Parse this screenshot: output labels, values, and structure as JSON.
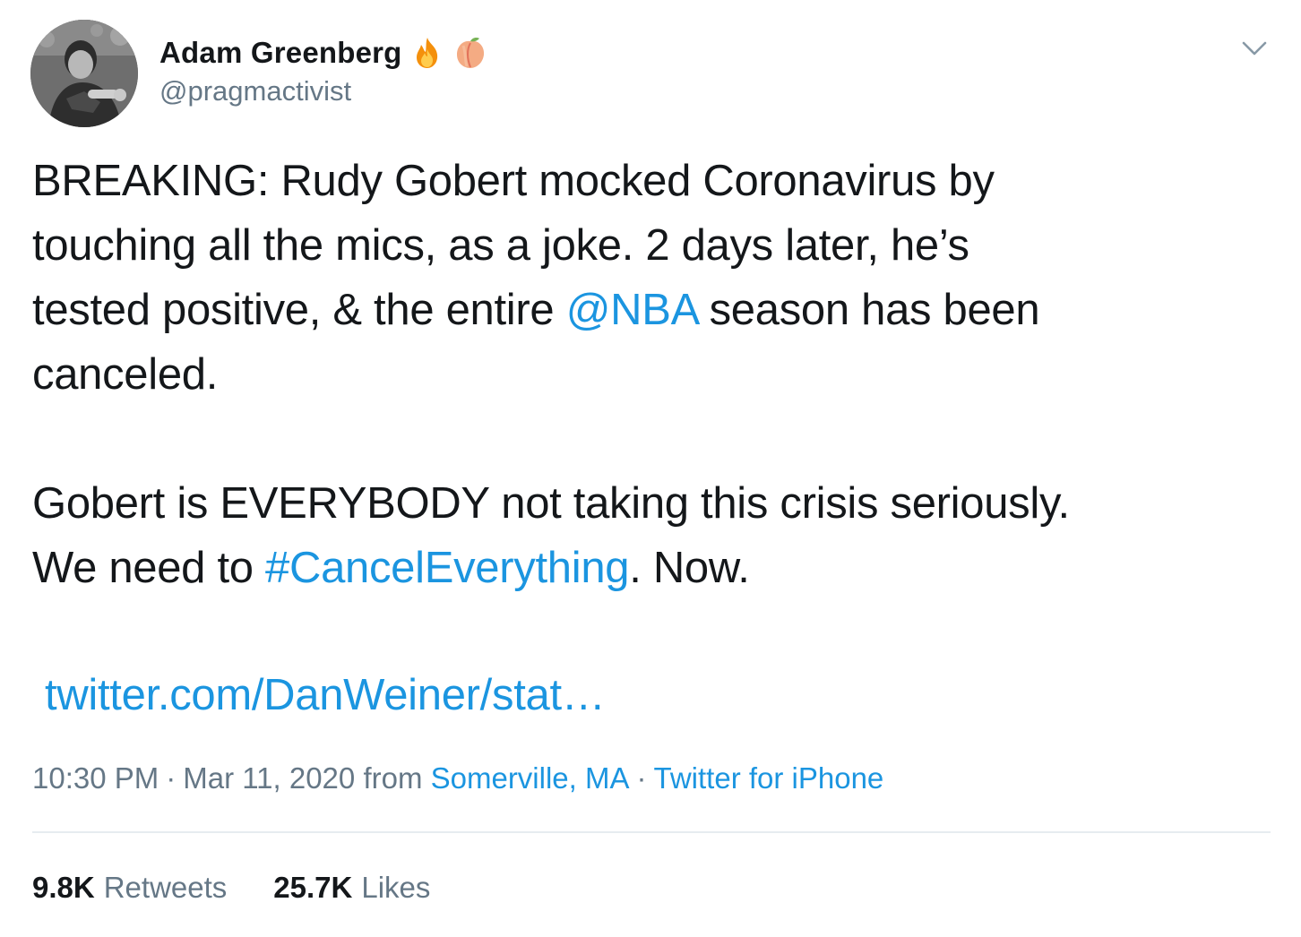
{
  "user": {
    "display_name": "Adam Greenberg",
    "handle": "@pragmactivist",
    "badges": [
      "fire-emoji",
      "peach-emoji"
    ]
  },
  "tweet": {
    "line1": "BREAKING: Rudy Gobert mocked Coronavirus by",
    "line2": "touching all the mics, as a joke. 2 days later, he’s",
    "line3_pre": "tested positive, & the entire ",
    "mention": "@NBA",
    "line3_post": " season has been",
    "line4": "canceled.",
    "line5": "Gobert is EVERYBODY not taking this crisis seriously.",
    "line6_pre": "We need to ",
    "hashtag": "#CancelEverything",
    "line6_post": ". Now.",
    "url": "twitter.com/DanWeiner/stat…"
  },
  "meta": {
    "time": "10:30 PM",
    "separator": "·",
    "date": "Mar 11, 2020",
    "from_label": "from",
    "location": "Somerville, MA",
    "source": "Twitter for iPhone"
  },
  "stats": {
    "retweets_count": "9.8K",
    "retweets_label": "Retweets",
    "likes_count": "25.7K",
    "likes_label": "Likes"
  },
  "colors": {
    "link": "#1b95e0",
    "text": "#14171a",
    "secondary": "#657786",
    "divider": "#e6ecf0"
  },
  "icons": {
    "menu": "chevron-down-icon"
  }
}
